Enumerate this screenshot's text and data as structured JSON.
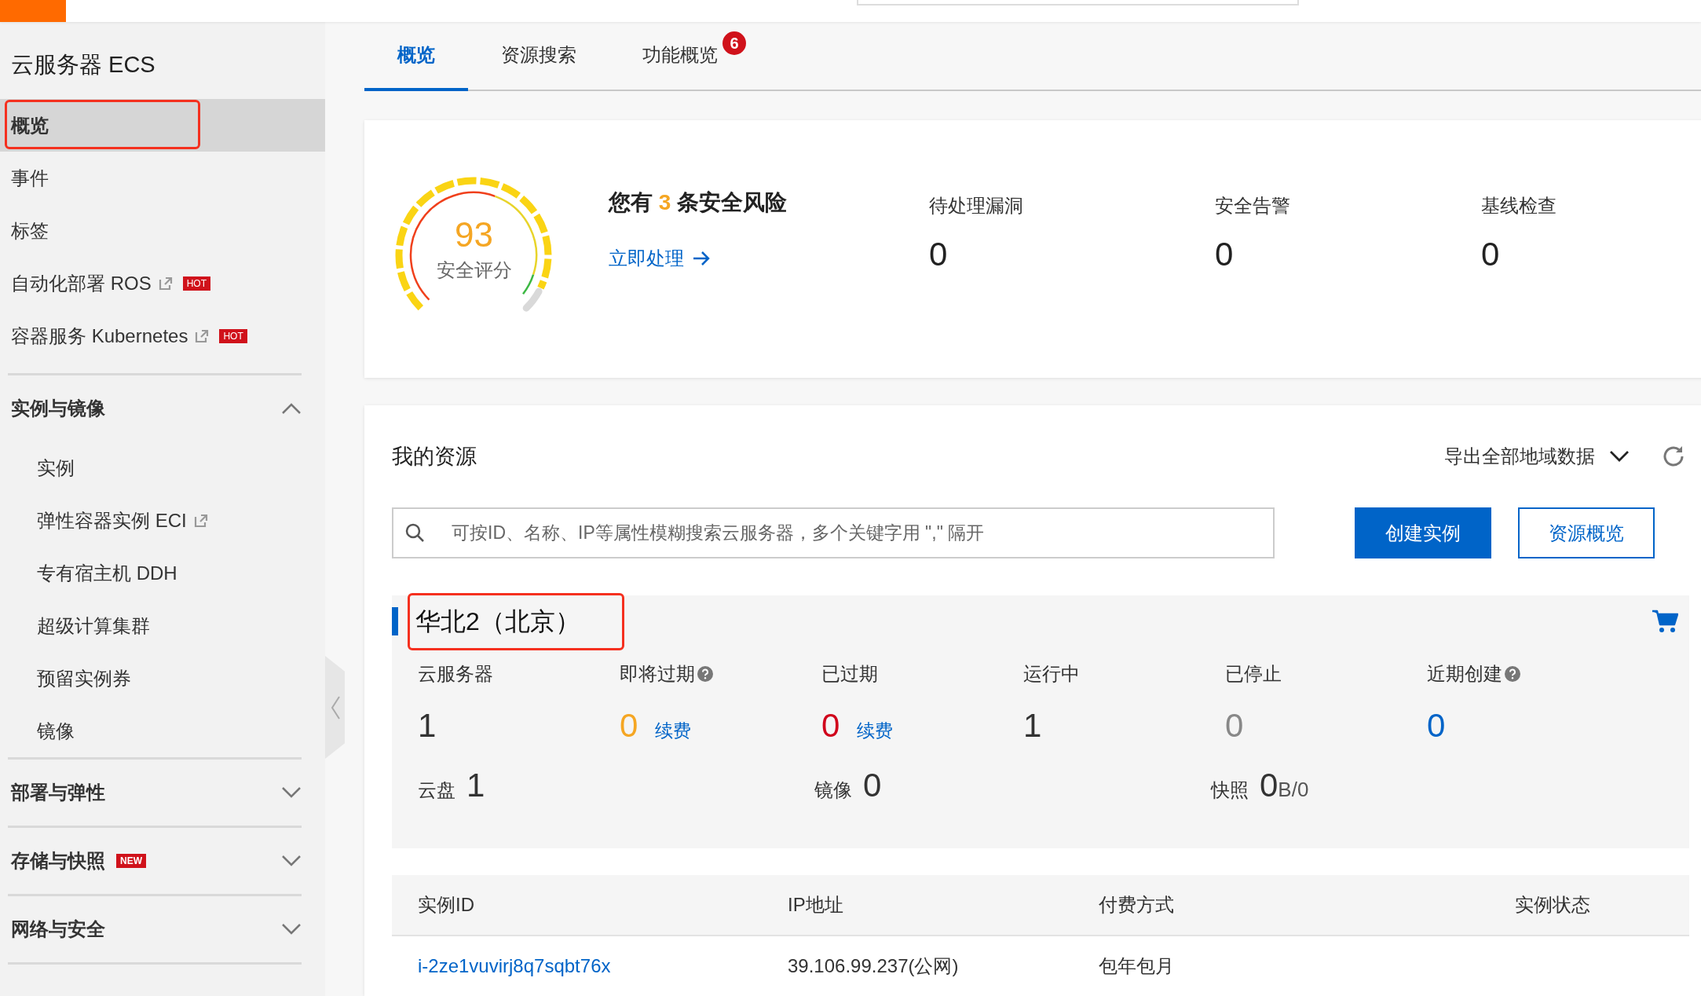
{
  "sidebar": {
    "title": "云服务器 ECS",
    "items": [
      {
        "label": "概览",
        "selected": true,
        "highlighted": true,
        "external": false
      },
      {
        "label": "事件",
        "selected": false,
        "highlighted": false,
        "external": false
      },
      {
        "label": "标签",
        "selected": false,
        "highlighted": false,
        "external": false
      },
      {
        "label": "自动化部署 ROS",
        "selected": false,
        "highlighted": false,
        "external": true,
        "badge": "HOT"
      },
      {
        "label": "容器服务 Kubernetes",
        "selected": false,
        "highlighted": false,
        "external": true,
        "badge": "HOT"
      }
    ],
    "sections": [
      {
        "label": "实例与镜像",
        "expanded": true,
        "children": [
          {
            "label": "实例",
            "external": false
          },
          {
            "label": "弹性容器实例 ECI",
            "external": true
          },
          {
            "label": "专有宿主机 DDH",
            "external": false
          },
          {
            "label": "超级计算集群",
            "external": false
          },
          {
            "label": "预留实例券",
            "external": false
          },
          {
            "label": "镜像",
            "external": false
          }
        ]
      },
      {
        "label": "部署与弹性",
        "expanded": false
      },
      {
        "label": "存储与快照",
        "expanded": false,
        "badge": "NEW"
      },
      {
        "label": "网络与安全",
        "expanded": false
      }
    ]
  },
  "tabs": [
    {
      "label": "概览",
      "selected": true
    },
    {
      "label": "资源搜索",
      "selected": false
    },
    {
      "label": "功能概览",
      "selected": false,
      "badge": "6"
    }
  ],
  "security": {
    "score": "93",
    "score_label": "安全评分",
    "risk_prefix": "您有",
    "risk_count": "3",
    "risk_suffix": "条安全风险",
    "action": "立即处理",
    "metrics": [
      {
        "label": "待处理漏洞",
        "value": "0"
      },
      {
        "label": "安全告警",
        "value": "0"
      },
      {
        "label": "基线检查",
        "value": "0"
      }
    ]
  },
  "resources": {
    "title": "我的资源",
    "export": "导出全部地域数据",
    "search": {
      "placeholder": "可按ID、名称、IP等属性模糊搜索云服务器，多个关键字用 \",\" 隔开"
    },
    "buttons": [
      {
        "label": "创建实例",
        "kind": "primary"
      },
      {
        "label": "资源概览",
        "kind": "secondary"
      }
    ],
    "region": {
      "name": "华北2（北京）",
      "highlighted": true,
      "stats": [
        {
          "label": "云服务器",
          "help": false,
          "value": "1",
          "color": "#333333"
        },
        {
          "label": "即将过期",
          "help": true,
          "value": "0",
          "color": "#f5a623",
          "link": "续费"
        },
        {
          "label": "已过期",
          "help": false,
          "value": "0",
          "color": "#d0021b",
          "link": "续费"
        },
        {
          "label": "运行中",
          "help": false,
          "value": "1",
          "color": "#333333"
        },
        {
          "label": "已停止",
          "help": false,
          "value": "0",
          "color": "#888888"
        },
        {
          "label": "近期创建",
          "help": true,
          "value": "0",
          "color": "#0064c8"
        }
      ],
      "extras": [
        {
          "label": "云盘",
          "value": "1"
        },
        {
          "label": "镜像",
          "value": "0"
        },
        {
          "label": "快照",
          "value": "0",
          "unit": "B/0"
        }
      ]
    },
    "table": {
      "columns": [
        "实例ID",
        "IP地址",
        "付费方式",
        "实例状态"
      ],
      "rows": [
        {
          "cells": [
            "i-2ze1vuvirj8q7sqbt76x",
            "39.106.99.237(公网)",
            "包年包月"
          ]
        }
      ]
    }
  }
}
